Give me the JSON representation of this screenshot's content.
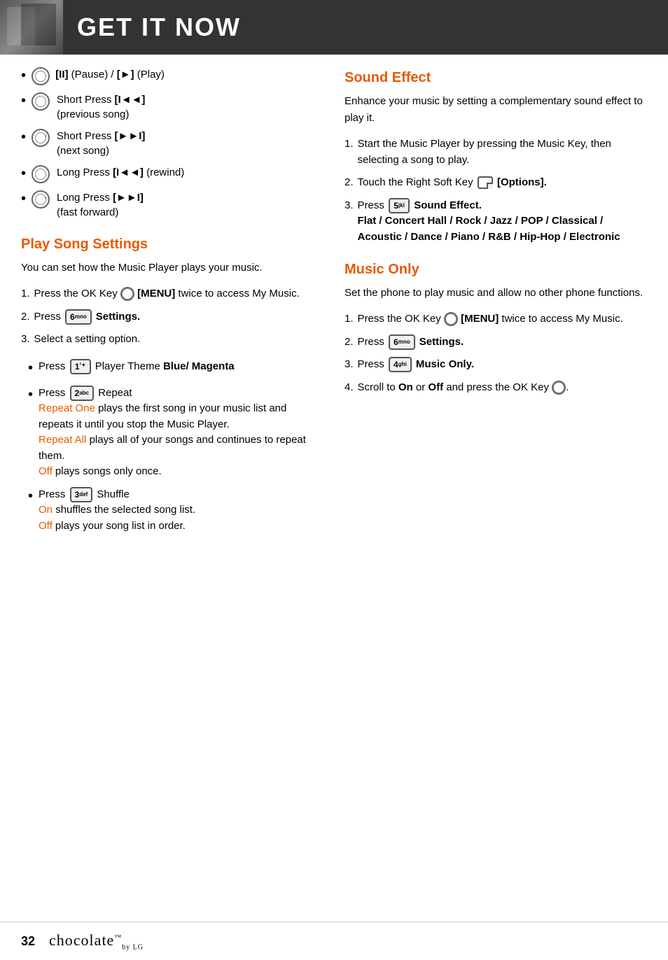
{
  "header": {
    "title": "GET IT NOW"
  },
  "left": {
    "bullets": [
      {
        "icon": "ok-circle",
        "text": "[II] (Pause) / [►] (Play)"
      },
      {
        "icon": "left-arrow-circle",
        "text": "Short Press [I◄◄]",
        "subtext": "(previous song)"
      },
      {
        "icon": "right-arrow-circle",
        "text": "Short Press [►►I]",
        "subtext": "(next song)"
      },
      {
        "icon": "left-arrow-circle",
        "text": "Long Press [I◄◄] (rewind)"
      },
      {
        "icon": "right-arrow-circle",
        "text": "Long Press [►►I]",
        "subtext": "(fast forward)"
      }
    ],
    "play_song_settings": {
      "title": "Play Song Settings",
      "intro": "You can set how the Music Player plays your music.",
      "steps": [
        {
          "num": "1.",
          "text": "Press the OK Key",
          "bold_suffix": "[MENU]",
          "suffix": "twice to access My Music."
        },
        {
          "num": "2.",
          "key": "6mno",
          "key_label": "6",
          "key_sup": "mno",
          "text": "Settings."
        },
        {
          "num": "3.",
          "text": "Select a setting option."
        }
      ],
      "sub_bullets": [
        {
          "key": "1",
          "key_sup": "°✦",
          "text": "Player Theme",
          "bold_text": "Blue/ Magenta"
        },
        {
          "key": "2",
          "key_sup": "abc",
          "text": "Repeat",
          "orange1": "Repeat One",
          "orange1_text": "plays the first song in your music list and repeats it until you stop the Music Player.",
          "orange2": "Repeat All",
          "orange2_text": "plays all of your songs and continues to repeat them.",
          "orange3": "Off",
          "orange3_text": "plays songs only once."
        },
        {
          "key": "3",
          "key_sup": "def",
          "text": "Shuffle",
          "orange1": "On",
          "orange1_text": "shuffles the selected song list.",
          "orange2": "Off",
          "orange2_text": "plays your song list in order."
        }
      ]
    }
  },
  "right": {
    "sound_effect": {
      "title": "Sound Effect",
      "intro": "Enhance your music by setting a complementary sound effect to play it.",
      "steps": [
        {
          "num": "1.",
          "text": "Start the Music Player by pressing the Music Key, then selecting a song to play."
        },
        {
          "num": "2.",
          "text": "Touch the Right Soft Key",
          "bracket_text": "[Options]."
        },
        {
          "num": "3.",
          "key": "5",
          "key_sup": "jkl",
          "text": "Sound Effect.",
          "bold_text": "Flat / Concert Hall / Rock / Jazz / POP / Classical / Acoustic / Dance / Piano / R&B / Hip-Hop / Electronic"
        }
      ]
    },
    "music_only": {
      "title": "Music Only",
      "intro": "Set the phone to play music and allow no other phone functions.",
      "steps": [
        {
          "num": "1.",
          "text": "Press the OK Key",
          "bold_suffix": "[MENU]",
          "suffix": "twice to access My Music."
        },
        {
          "num": "2.",
          "key": "6",
          "key_sup": "mno",
          "text": "Settings."
        },
        {
          "num": "3.",
          "key": "4",
          "key_sup": "ghi",
          "text": "Music Only."
        },
        {
          "num": "4.",
          "text": "Scroll to",
          "bold1": "On",
          "mid_text": "or",
          "bold2": "Off",
          "suffix": "and press the OK Key",
          "has_ok_icon": true
        }
      ]
    }
  },
  "footer": {
    "page_num": "32",
    "brand": "chocolate"
  }
}
